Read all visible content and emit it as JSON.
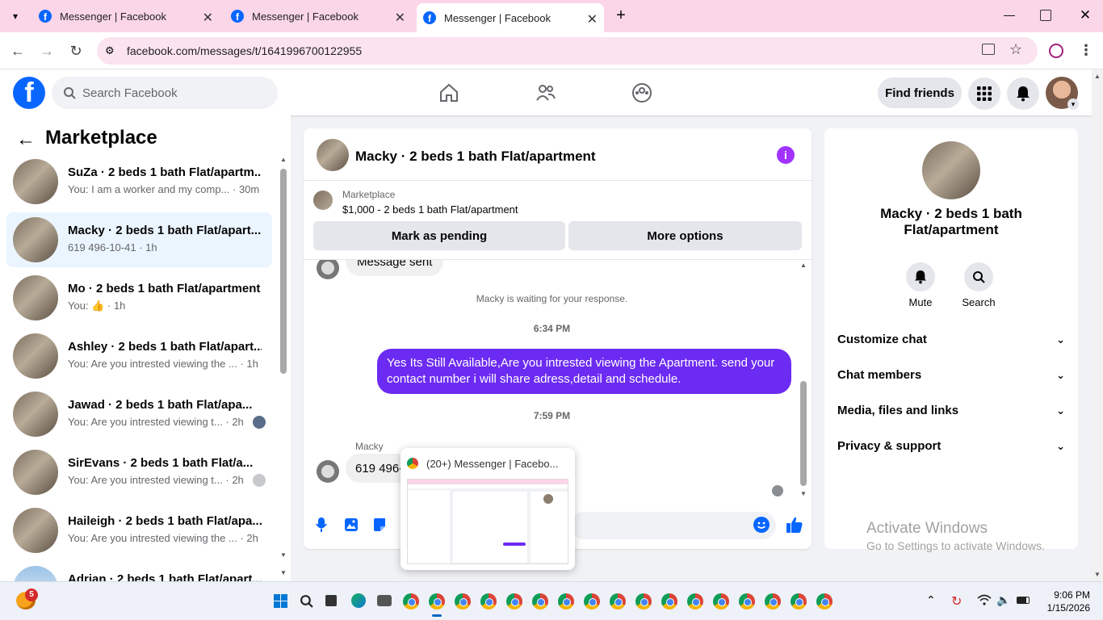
{
  "browser": {
    "tabs": [
      {
        "title": "Messenger | Facebook"
      },
      {
        "title": "Messenger | Facebook"
      },
      {
        "title": "Messenger | Facebook"
      }
    ],
    "url": "facebook.com/messages/t/1641996700122955"
  },
  "fb": {
    "search_placeholder": "Search Facebook",
    "find_friends": "Find friends"
  },
  "sidebar": {
    "title": "Marketplace",
    "conversations": [
      {
        "name": "SuZa · 2 beds 1 bath Flat/apartm...",
        "preview": "You: I am a worker and my comp...",
        "time": "· 30m"
      },
      {
        "name": "Macky · 2 beds 1 bath Flat/apart...",
        "preview": "619 496-10-41",
        "time": "· 1h"
      },
      {
        "name": "Mo · 2 beds 1 bath Flat/apartment",
        "preview": "You:",
        "time": "· 1h"
      },
      {
        "name": "Ashley · 2 beds 1 bath Flat/apart...",
        "preview": "You: Are you intrested viewing the ...",
        "time": "· 1h"
      },
      {
        "name": "Jawad · 2 beds 1 bath Flat/apa...",
        "preview": "You: Are you intrested viewing t...",
        "time": "· 2h"
      },
      {
        "name": "SirEvans · 2 beds 1 bath Flat/a...",
        "preview": "You: Are you intrested viewing t...",
        "time": "· 2h"
      },
      {
        "name": "Haileigh · 2 beds 1 bath Flat/apa...",
        "preview": "You: Are you intrested viewing the ...",
        "time": "· 2h"
      },
      {
        "name": "Adrian · 2 beds 1 bath Flat/apart...",
        "preview": "",
        "time": ""
      }
    ]
  },
  "chat": {
    "title": "Macky · 2 beds 1 bath Flat/apartment",
    "listing_source": "Marketplace",
    "listing_detail": "$1,000 - 2 beds 1 bath Flat/apartment",
    "mark_pending": "Mark as pending",
    "more_options": "More options",
    "message_sent": "Message sent",
    "waiting": "Macky is waiting for your response.",
    "time1": "6:34 PM",
    "outgoing": "Yes Its Still Available,Are you intrested viewing the Apartment. send your contact number i will share adress,detail and schedule.",
    "time2": "7:59 PM",
    "sender": "Macky",
    "incoming": "619 496-"
  },
  "tooltip": {
    "title": "(20+) Messenger | Facebo..."
  },
  "info": {
    "name": "Macky · 2 beds 1 bath Flat/apartment",
    "mute": "Mute",
    "search": "Search",
    "sections": [
      "Customize chat",
      "Chat members",
      "Media, files and links",
      "Privacy & support"
    ]
  },
  "watermark": {
    "line1": "Activate Windows",
    "line2": "Go to Settings to activate Windows."
  },
  "taskbar": {
    "badge": "5",
    "time": "9:06 PM",
    "date": "1/15/2026"
  }
}
